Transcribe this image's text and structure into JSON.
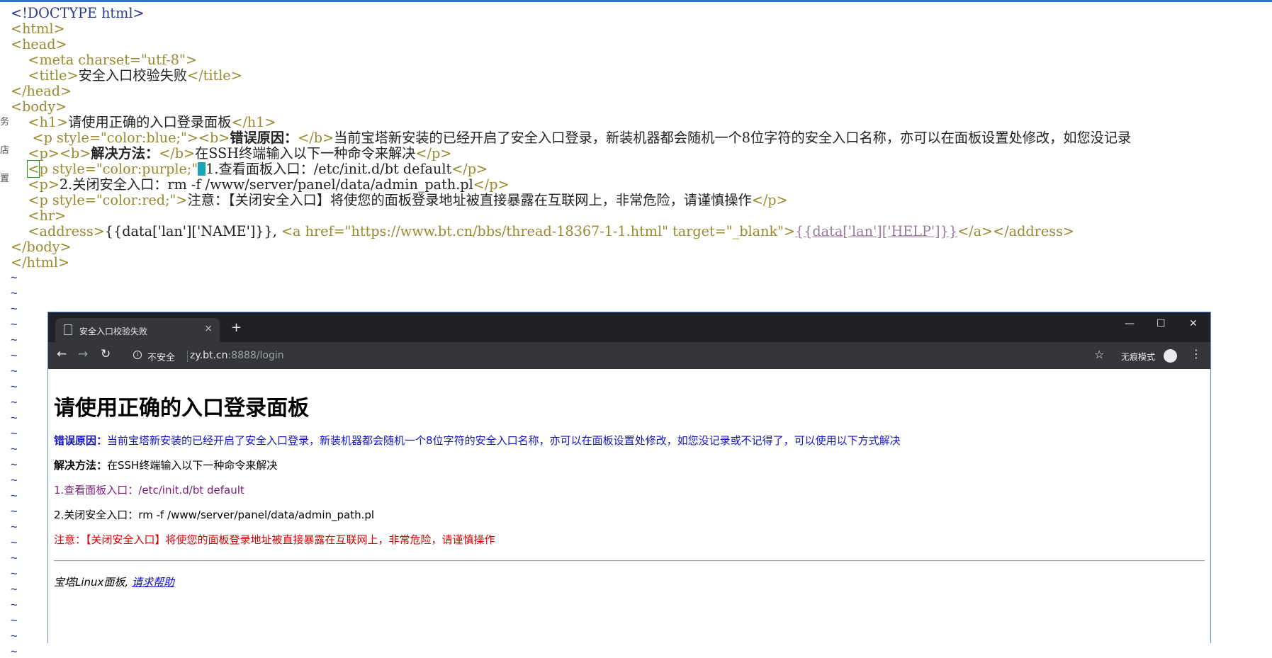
{
  "editor": {
    "lines": {
      "doctype": "<!DOCTYPE html>",
      "html_open": "<html>",
      "head_open": "<head>",
      "meta": "<meta charset=\"utf-8\">",
      "title_open": "<title>",
      "title_text": "安全入口校验失败",
      "title_close": "</title>",
      "head_close": "</head>",
      "body_open": "<body>",
      "h1_open": "<h1>",
      "h1_text": "请使用正确的入口登录面板",
      "h1_close": "</h1>",
      "p_blue_open": "<p style=\"color:blue;\">",
      "b_open": "<b>",
      "b1_text": "错误原因：",
      "b_close": "</b>",
      "p1_text": "当前宝塔新安装的已经开启了安全入口登录，新装机器都会随机一个8位字符的安全入口名称，亦可以在面板设置处修改，如您没记录",
      "p_open": "<p>",
      "b2_text": "解决方法：",
      "p2_text": "在SSH终端输入以下一种命令来解决",
      "p_close": "</p>",
      "p_purple_head": "p style=\"color:purple;\"",
      "p3_text": "1.查看面板入口：/etc/init.d/bt default",
      "p4_text": "2.关闭安全入口：rm -f /www/server/panel/data/admin_path.pl",
      "p_red_open": "<p style=\"color:red;\">",
      "p5_text": "注意：【关闭安全入口】将使您的面板登录地址被直接暴露在互联网上，非常危险，请谨慎操作",
      "hr": "<hr>",
      "address_open": "<address>",
      "address_name": "{{data['lan']['NAME']}}, ",
      "a_open": "<a href=\"https://www.bt.cn/bbs/thread-18367-1-1.html\" target=\"_blank\">",
      "a_text": "{{data['lan']['HELP']}}",
      "a_close": "</a>",
      "address_close": "</address>",
      "body_close": "</body>",
      "html_close": "</html>"
    },
    "gutter_chars": [
      "务",
      "店",
      "置"
    ],
    "tilde": "~"
  },
  "browser": {
    "tab_title": "安全入口校验失败",
    "tab_close": "×",
    "new_tab": "+",
    "win_minimize": "—",
    "win_maximize": "☐",
    "win_close": "✕",
    "nav_back": "←",
    "nav_forward": "→",
    "nav_reload": "↻",
    "info_icon_glyph": "i",
    "insecure_label": "不安全",
    "url_host": "zy.bt.cn",
    "url_rest": ":8888/login",
    "bookmark_star": "☆",
    "incognito_label": "无痕模式",
    "menu_dots": "⋮"
  },
  "page": {
    "h1": "请使用正确的入口登录面板",
    "error_label": "错误原因：",
    "error_text": "当前宝塔新安装的已经开启了安全入口登录，新装机器都会随机一个8位字符的安全入口名称，亦可以在面板设置处修改，如您没记录或不记得了，可以使用以下方式解决",
    "solution_label": "解决方法：",
    "solution_text": "在SSH终端输入以下一种命令来解决",
    "cmd1": "1.查看面板入口：/etc/init.d/bt default",
    "cmd2": "2.关闭安全入口：rm -f /www/server/panel/data/admin_path.pl",
    "warning": "注意：【关闭安全入口】将使您的面板登录地址被直接暴露在互联网上，非常危险，请谨慎操作",
    "address_name": "宝塔Linux面板,",
    "help_link": "请求帮助"
  }
}
